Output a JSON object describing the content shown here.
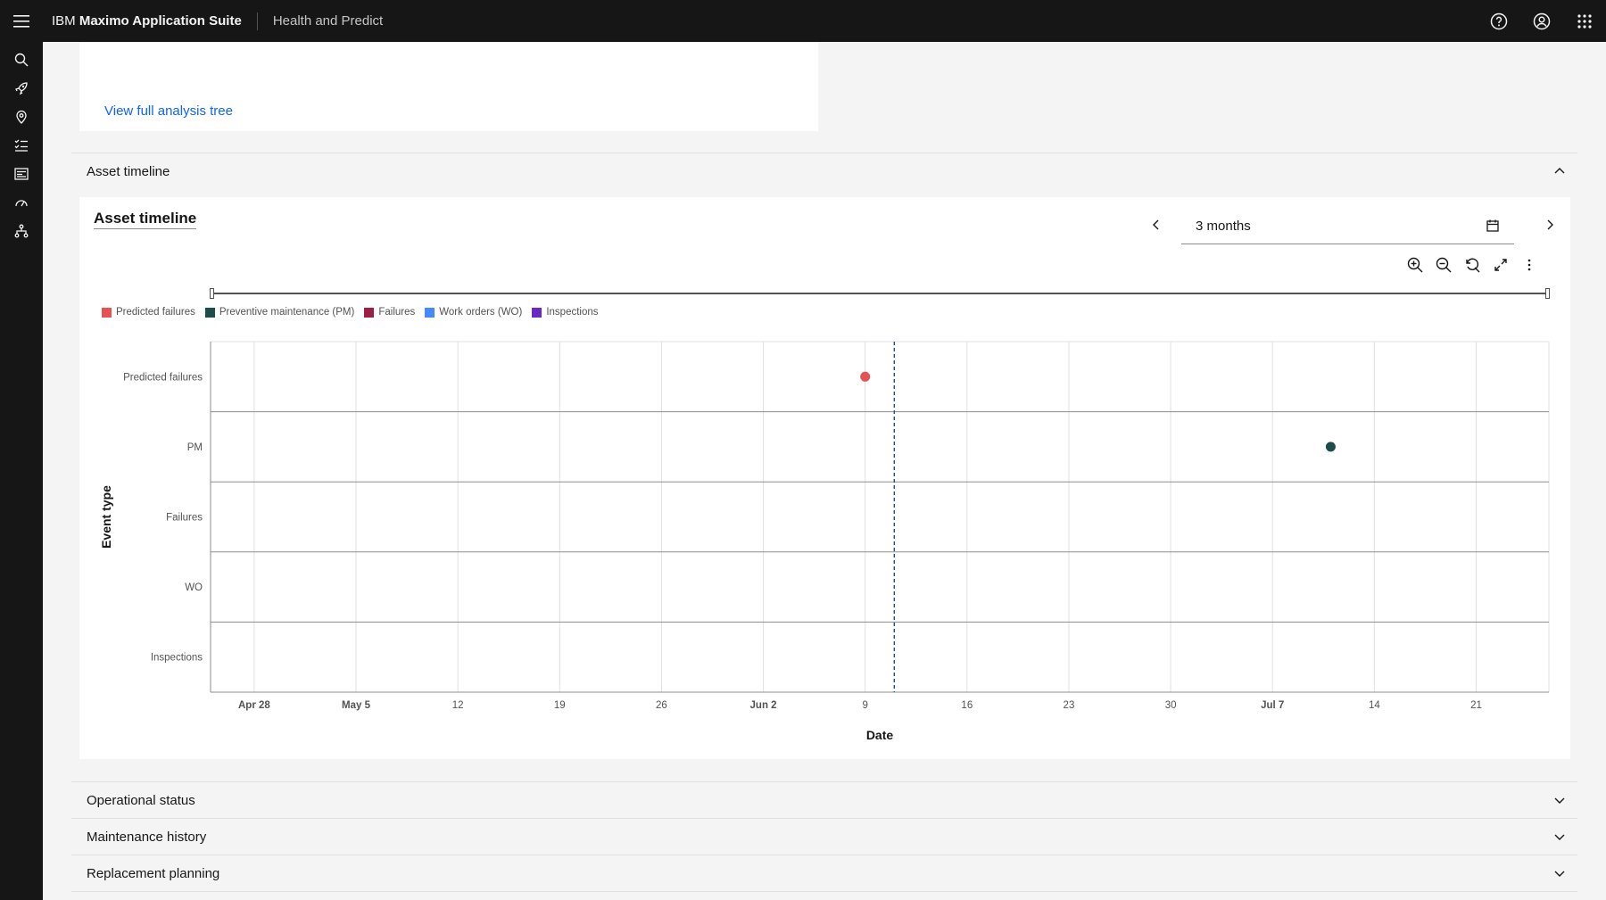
{
  "header": {
    "brand_prefix": "IBM",
    "brand_name": "Maximo Application Suite",
    "app_name": "Health and Predict"
  },
  "top_card": {
    "link_label": "View full analysis tree"
  },
  "accordion": {
    "asset_timeline": "Asset timeline",
    "operational_status": "Operational status",
    "maintenance_history": "Maintenance history",
    "replacement_planning": "Replacement planning"
  },
  "timeline": {
    "title": "Asset timeline",
    "range_value": "3 months"
  },
  "colors": {
    "predicted_failures": "#e65253",
    "preventive_maintenance": "#1d4d4b",
    "failures": "#9f1f44",
    "work_orders": "#4589ff",
    "inspections": "#6929c4",
    "today_line": "#1f4a9e"
  },
  "chart_data": {
    "type": "scatter",
    "title": "",
    "xlabel": "Date",
    "ylabel": "Event type",
    "legend_position": "top-left",
    "grid": true,
    "xlim": [
      "2024-04-25",
      "2024-07-26"
    ],
    "x_ticks": [
      {
        "date": "2024-04-28",
        "label": "Apr 28",
        "bold": true
      },
      {
        "date": "2024-05-05",
        "label": "May 5",
        "bold": true
      },
      {
        "date": "2024-05-12",
        "label": "12",
        "bold": false
      },
      {
        "date": "2024-05-19",
        "label": "19",
        "bold": false
      },
      {
        "date": "2024-05-26",
        "label": "26",
        "bold": false
      },
      {
        "date": "2024-06-02",
        "label": "Jun 2",
        "bold": true
      },
      {
        "date": "2024-06-09",
        "label": "9",
        "bold": false
      },
      {
        "date": "2024-06-16",
        "label": "16",
        "bold": false
      },
      {
        "date": "2024-06-23",
        "label": "23",
        "bold": false
      },
      {
        "date": "2024-06-30",
        "label": "30",
        "bold": false
      },
      {
        "date": "2024-07-07",
        "label": "Jul 7",
        "bold": true
      },
      {
        "date": "2024-07-14",
        "label": "14",
        "bold": false
      },
      {
        "date": "2024-07-21",
        "label": "21",
        "bold": false
      }
    ],
    "categories": [
      "Predicted failures",
      "PM",
      "Failures",
      "WO",
      "Inspections"
    ],
    "series": [
      {
        "name": "Predicted failures",
        "color": "#e65253",
        "points": [
          {
            "date": "2024-06-09",
            "category": "Predicted failures"
          }
        ]
      },
      {
        "name": "Preventive maintenance (PM)",
        "color": "#1d4d4b",
        "points": [
          {
            "date": "2024-07-11",
            "category": "PM"
          }
        ]
      },
      {
        "name": "Failures",
        "color": "#9f1f44",
        "points": []
      },
      {
        "name": "Work orders (WO)",
        "color": "#4589ff",
        "points": []
      },
      {
        "name": "Inspections",
        "color": "#6929c4",
        "points": []
      }
    ],
    "today": "2024-06-11"
  }
}
